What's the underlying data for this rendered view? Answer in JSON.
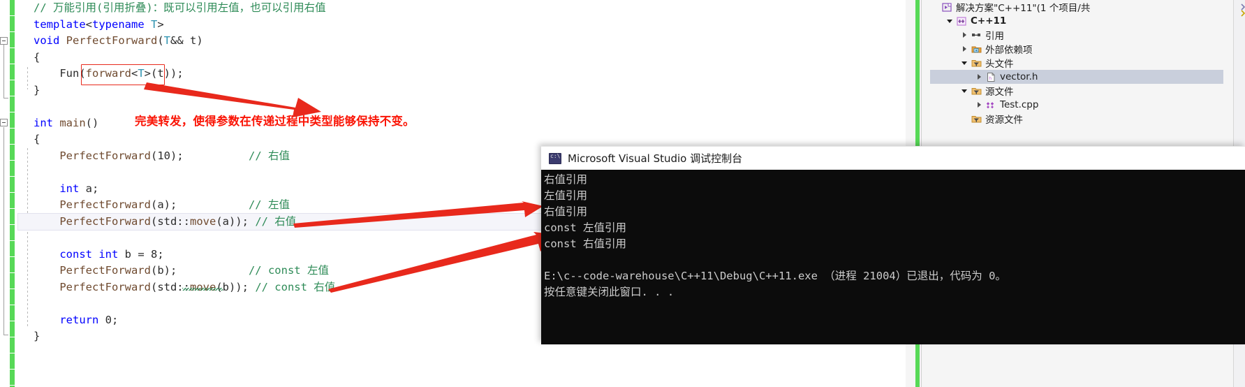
{
  "editor": {
    "language": "cpp",
    "code_lines": [
      {
        "indent": 0,
        "tokens": [
          {
            "t": "// 万能引用(引用折叠)：既可以引用左值，也可以引用右值",
            "c": "cmt"
          }
        ]
      },
      {
        "indent": 0,
        "tokens": [
          {
            "t": "template",
            "c": "kw"
          },
          {
            "t": "<",
            "c": "op"
          },
          {
            "t": "typename",
            "c": "kw"
          },
          {
            "t": " ",
            "c": "op"
          },
          {
            "t": "T",
            "c": "typ"
          },
          {
            "t": ">",
            "c": "op"
          }
        ]
      },
      {
        "indent": 0,
        "tokens": [
          {
            "t": "void",
            "c": "kw"
          },
          {
            "t": " ",
            "c": "op"
          },
          {
            "t": "PerfectForward",
            "c": "fn"
          },
          {
            "t": "(",
            "c": "op"
          },
          {
            "t": "T",
            "c": "typ"
          },
          {
            "t": "&& t)",
            "c": "op"
          }
        ]
      },
      {
        "indent": 0,
        "tokens": [
          {
            "t": "{",
            "c": "op"
          }
        ]
      },
      {
        "indent": 0,
        "tokens": [
          {
            "t": "    Fun(",
            "c": "op"
          },
          {
            "t": "forward",
            "c": "fn"
          },
          {
            "t": "<",
            "c": "op"
          },
          {
            "t": "T",
            "c": "typ"
          },
          {
            "t": ">(t));",
            "c": "op"
          }
        ]
      },
      {
        "indent": 0,
        "tokens": [
          {
            "t": "}",
            "c": "op"
          }
        ]
      },
      {
        "indent": 0,
        "tokens": [
          {
            "t": "",
            "c": "op"
          }
        ]
      },
      {
        "indent": 0,
        "tokens": [
          {
            "t": "int",
            "c": "kw"
          },
          {
            "t": " ",
            "c": "op"
          },
          {
            "t": "main",
            "c": "fn"
          },
          {
            "t": "()",
            "c": "op"
          }
        ]
      },
      {
        "indent": 0,
        "tokens": [
          {
            "t": "{",
            "c": "op"
          }
        ]
      },
      {
        "indent": 0,
        "tokens": [
          {
            "t": "    PerfectForward",
            "c": "fn"
          },
          {
            "t": "(",
            "c": "op"
          },
          {
            "t": "10",
            "c": "num"
          },
          {
            "t": ");",
            "c": "op"
          },
          {
            "t": "          ",
            "c": "op"
          },
          {
            "t": "// 右值",
            "c": "cmt"
          }
        ]
      },
      {
        "indent": 0,
        "tokens": [
          {
            "t": "",
            "c": "op"
          }
        ]
      },
      {
        "indent": 0,
        "tokens": [
          {
            "t": "    ",
            "c": "op"
          },
          {
            "t": "int",
            "c": "kw"
          },
          {
            "t": " a;",
            "c": "op"
          }
        ]
      },
      {
        "indent": 0,
        "tokens": [
          {
            "t": "    PerfectForward",
            "c": "fn"
          },
          {
            "t": "(a);",
            "c": "op"
          },
          {
            "t": "           ",
            "c": "op"
          },
          {
            "t": "// 左值",
            "c": "cmt"
          }
        ]
      },
      {
        "indent": 0,
        "tokens": [
          {
            "t": "    PerfectForward",
            "c": "fn"
          },
          {
            "t": "(std::",
            "c": "op"
          },
          {
            "t": "move",
            "c": "fn"
          },
          {
            "t": "(a)); ",
            "c": "op"
          },
          {
            "t": "// 右值",
            "c": "cmt"
          }
        ]
      },
      {
        "indent": 0,
        "tokens": [
          {
            "t": "",
            "c": "op"
          }
        ]
      },
      {
        "indent": 0,
        "tokens": [
          {
            "t": "    ",
            "c": "op"
          },
          {
            "t": "const",
            "c": "kw"
          },
          {
            "t": " ",
            "c": "op"
          },
          {
            "t": "int",
            "c": "kw"
          },
          {
            "t": " b = ",
            "c": "op"
          },
          {
            "t": "8",
            "c": "num"
          },
          {
            "t": ";",
            "c": "op"
          }
        ]
      },
      {
        "indent": 0,
        "tokens": [
          {
            "t": "    PerfectForward",
            "c": "fn"
          },
          {
            "t": "(b);",
            "c": "op"
          },
          {
            "t": "           ",
            "c": "op"
          },
          {
            "t": "// const 左值",
            "c": "cmt"
          }
        ]
      },
      {
        "indent": 0,
        "tokens": [
          {
            "t": "    PerfectForward",
            "c": "fn"
          },
          {
            "t": "(std::",
            "c": "op"
          },
          {
            "t": "move",
            "c": "fn"
          },
          {
            "t": "(b)); ",
            "c": "op"
          },
          {
            "t": "// const 右值",
            "c": "cmt"
          }
        ]
      },
      {
        "indent": 0,
        "tokens": [
          {
            "t": "",
            "c": "op"
          }
        ]
      },
      {
        "indent": 0,
        "tokens": [
          {
            "t": "    ",
            "c": "op"
          },
          {
            "t": "return",
            "c": "kw"
          },
          {
            "t": " ",
            "c": "op"
          },
          {
            "t": "0",
            "c": "num"
          },
          {
            "t": ";",
            "c": "op"
          }
        ]
      },
      {
        "indent": 0,
        "tokens": [
          {
            "t": "}",
            "c": "op"
          }
        ]
      }
    ],
    "annotation": "完美转发，使得参数在传递过程中类型能够保持不变。",
    "annotation_color": "#fa1405",
    "highlight_box_label": "forward<T>(t)",
    "current_line_text": "PerfectForward(std::move(a)); // 右值"
  },
  "solution_explorer": {
    "items": [
      {
        "label": "解决方案\"C++11\"(1 个项目/共",
        "icon": "solution-icon",
        "depth": 0,
        "twisty": "none",
        "bold": false,
        "selected": false
      },
      {
        "label": "C++11",
        "icon": "project-icon",
        "depth": 1,
        "twisty": "down",
        "bold": true,
        "selected": false
      },
      {
        "label": "引用",
        "icon": "references-icon",
        "depth": 2,
        "twisty": "right",
        "bold": false,
        "selected": false
      },
      {
        "label": "外部依赖项",
        "icon": "external-icon",
        "depth": 2,
        "twisty": "right",
        "bold": false,
        "selected": false
      },
      {
        "label": "头文件",
        "icon": "filter-icon",
        "depth": 2,
        "twisty": "down",
        "bold": false,
        "selected": false
      },
      {
        "label": "vector.h",
        "icon": "header-file-icon",
        "depth": 3,
        "twisty": "right",
        "bold": false,
        "selected": true
      },
      {
        "label": "源文件",
        "icon": "filter-icon",
        "depth": 2,
        "twisty": "down",
        "bold": false,
        "selected": false
      },
      {
        "label": "Test.cpp",
        "icon": "cpp-file-icon",
        "depth": 3,
        "twisty": "right",
        "bold": false,
        "selected": false
      },
      {
        "label": "资源文件",
        "icon": "filter-icon",
        "depth": 2,
        "twisty": "none",
        "bold": false,
        "selected": false
      }
    ]
  },
  "console": {
    "title": "Microsoft Visual Studio 调试控制台",
    "icon": "console-app-icon",
    "lines": [
      "右值引用",
      "左值引用",
      "右值引用",
      "const 左值引用",
      "const 右值引用",
      "",
      "E:\\c--code-warehouse\\C++11\\Debug\\C++11.exe （进程 21004）已退出，代码为 0。",
      "按任意键关闭此窗口. . ."
    ],
    "background": "#0c0c0c",
    "foreground": "#cccccc"
  }
}
